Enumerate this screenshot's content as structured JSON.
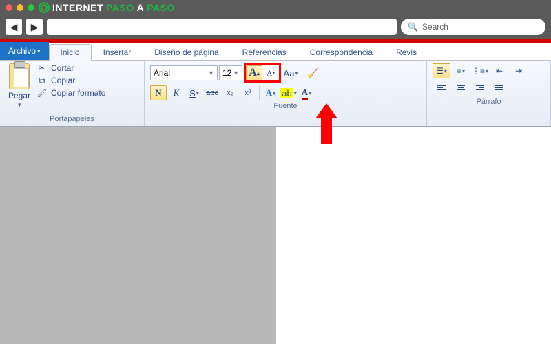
{
  "brand": {
    "part1": "INTERNET",
    "part2": "PASO",
    "part3": "A",
    "part4": "PASO"
  },
  "search": {
    "placeholder": "Search"
  },
  "tabs": {
    "file": "Archivo",
    "items": [
      "Inicio",
      "Insertar",
      "Diseño de página",
      "Referencias",
      "Correspondencia",
      "Revis"
    ]
  },
  "clipboard": {
    "paste": "Pegar",
    "cut": "Cortar",
    "copy": "Copiar",
    "format_painter": "Copiar formato",
    "group_label": "Portapapeles"
  },
  "font": {
    "name": "Arial",
    "size": "12",
    "grow": "A",
    "shrink": "A",
    "change_case": "Aa",
    "bold": "N",
    "italic": "K",
    "underline": "S",
    "strike": "abc",
    "subscript": "x₂",
    "superscript": "x²",
    "highlight": "ab",
    "font_color": "A",
    "group_label": "Fuente"
  },
  "paragraph": {
    "group_label": "Párrafo"
  }
}
